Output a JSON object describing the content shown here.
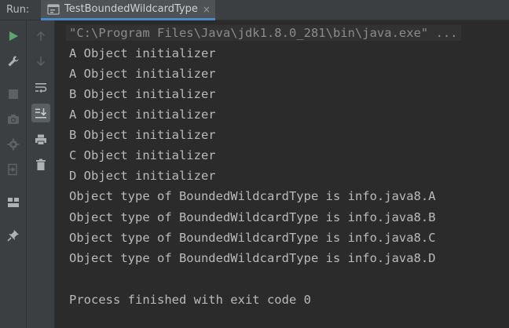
{
  "run_panel": {
    "label": "Run:",
    "tab": {
      "title": "TestBoundedWildcardType",
      "icon": "run-config-icon",
      "close_glyph": "×"
    }
  },
  "toolbar_primary": [
    {
      "icon": "rerun-icon",
      "color": "#59a869"
    },
    {
      "icon": "wrench-icon",
      "color": "#afb1b3"
    },
    {
      "icon": "stop-icon",
      "color": "#5e6061"
    },
    {
      "icon": "camera-icon",
      "color": "#5e6061"
    },
    {
      "icon": "debug-settings-icon",
      "color": "#5e6061"
    },
    {
      "icon": "exit-icon",
      "color": "#5e6061"
    },
    {
      "icon": "layout-icon",
      "color": "#afb1b3"
    },
    {
      "icon": "pin-icon",
      "color": "#afb1b3"
    }
  ],
  "toolbar_secondary": [
    {
      "icon": "arrow-up-icon",
      "color": "#5e6061"
    },
    {
      "icon": "arrow-down-icon",
      "color": "#5e6061"
    },
    {
      "icon": "soft-wrap-icon",
      "color": "#afb1b3"
    },
    {
      "icon": "scroll-to-end-icon",
      "color": "#afb1b3",
      "active": true
    },
    {
      "icon": "print-icon",
      "color": "#afb1b3"
    },
    {
      "icon": "trash-icon",
      "color": "#afb1b3"
    }
  ],
  "console": {
    "command_line": "\"C:\\Program Files\\Java\\jdk1.8.0_281\\bin\\java.exe\" ...",
    "lines": [
      "A Object initializer",
      "A Object initializer",
      "B Object initializer",
      "A Object initializer",
      "B Object initializer",
      "C Object initializer",
      "D Object initializer",
      "Object type of BoundedWildcardType is info.java8.A",
      "Object type of BoundedWildcardType is info.java8.B",
      "Object type of BoundedWildcardType is info.java8.C",
      "Object type of BoundedWildcardType is info.java8.D",
      "",
      "Process finished with exit code 0"
    ]
  },
  "colors": {
    "background": "#2b2b2b",
    "panel": "#3c3f41",
    "text": "#bababa",
    "command_text": "#8b8b8b",
    "tab_accent": "#4a88c7"
  }
}
